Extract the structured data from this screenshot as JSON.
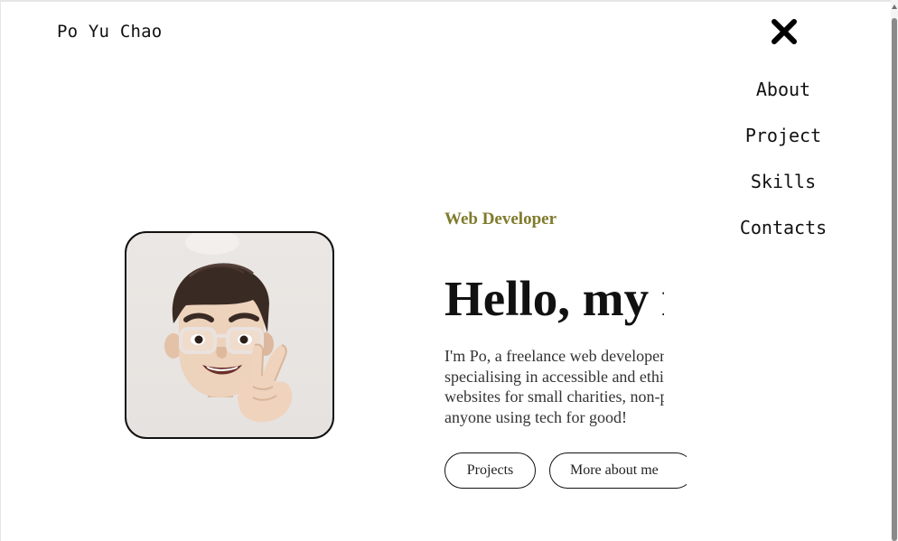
{
  "header": {
    "logo_text": "Po Yu Chao",
    "close_icon": "close-x-icon"
  },
  "nav": {
    "items": [
      {
        "label": "About"
      },
      {
        "label": "Project"
      },
      {
        "label": "Skills"
      },
      {
        "label": "Contacts"
      }
    ]
  },
  "hero": {
    "avatar_icon": "memoji-avatar",
    "role": "Web Developer",
    "title": "Hello, my name is Po",
    "intro": "I'm Po, a freelance web developer specialising in accessible and ethical websites for small charities, non-profits and anyone using tech for good!",
    "buttons": {
      "projects_label": "Projects",
      "more_label": "More about me"
    }
  },
  "colors": {
    "role_accent": "#7f7b2c",
    "text_primary": "#111111",
    "avatar_bg": "#ebe7e4"
  }
}
